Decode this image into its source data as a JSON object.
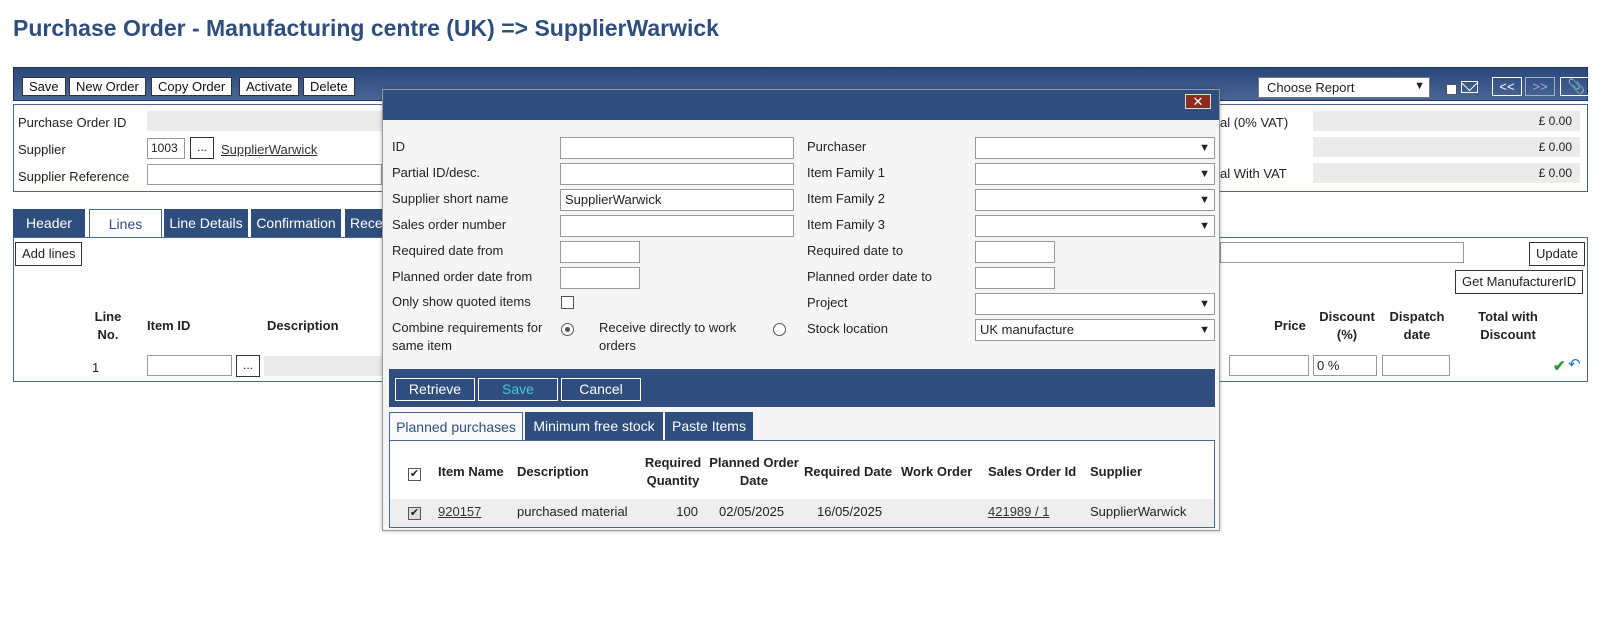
{
  "page": {
    "title": "Purchase Order - Manufacturing centre (UK) => SupplierWarwick"
  },
  "toolbar": {
    "save": "Save",
    "new_order": "New Order",
    "copy_order": "Copy Order",
    "activate": "Activate",
    "delete": "Delete",
    "report_select": "Choose Report",
    "prev": "<<",
    "next": ">>"
  },
  "header": {
    "po_id_label": "Purchase Order ID",
    "supplier_label": "Supplier",
    "supplier_code": "1003",
    "dots": "...",
    "supplier_link": "SupplierWarwick",
    "supplier_ref_label": "Supplier Reference",
    "total_novat_label": "al (0% VAT)",
    "total_novat": "£ 0.00",
    "total_mid": "£ 0.00",
    "total_vat_label": "al With VAT",
    "total_vat": "£ 0.00"
  },
  "tabs": [
    "Header",
    "Lines",
    "Line Details",
    "Confirmation",
    "Rece"
  ],
  "lines": {
    "add_lines": "Add lines",
    "update": "Update",
    "get_manufacturer": "Get ManufacturerID",
    "columns": {
      "line_no": "Line No.",
      "item_id": "Item ID",
      "description": "Description",
      "price": "Price",
      "discount": "Discount (%)",
      "dispatch": "Dispatch date",
      "total": "Total with Discount"
    },
    "row": {
      "line": "1",
      "discount": "0 %"
    }
  },
  "modal": {
    "fields": {
      "id": "ID",
      "partial": "Partial ID/desc.",
      "supplier_short": "Supplier short name",
      "supplier_short_value": "SupplierWarwick",
      "sales_order": "Sales order number",
      "req_from": "Required date from",
      "planned_from": "Planned order date from",
      "only_quoted": "Only show quoted items",
      "combine": "Combine requirements for same item",
      "receive_direct": "Receive directly to work orders",
      "purchaser": "Purchaser",
      "family1": "Item Family 1",
      "family2": "Item Family 2",
      "family3": "Item Family 3",
      "req_to": "Required date to",
      "planned_to": "Planned order date to",
      "project": "Project",
      "stock_location": "Stock location",
      "stock_location_value": "UK manufacture"
    },
    "actions": {
      "retrieve": "Retrieve",
      "save": "Save",
      "cancel": "Cancel"
    },
    "tabs": [
      "Planned purchases",
      "Minimum free stock",
      "Paste Items"
    ],
    "grid": {
      "headers": {
        "item_name": "Item Name",
        "description": "Description",
        "req_qty": "Required Quantity",
        "planned_date": "Planned Order Date",
        "req_date": "Required Date",
        "work_order": "Work Order",
        "sales_order": "Sales Order Id",
        "supplier": "Supplier"
      },
      "row": {
        "item_name": "920157",
        "description": "purchased material",
        "req_qty": "100",
        "planned_date": "02/05/2025",
        "req_date": "16/05/2025",
        "work_order": "",
        "sales_order": "421989 / 1",
        "supplier": "SupplierWarwick"
      }
    }
  }
}
